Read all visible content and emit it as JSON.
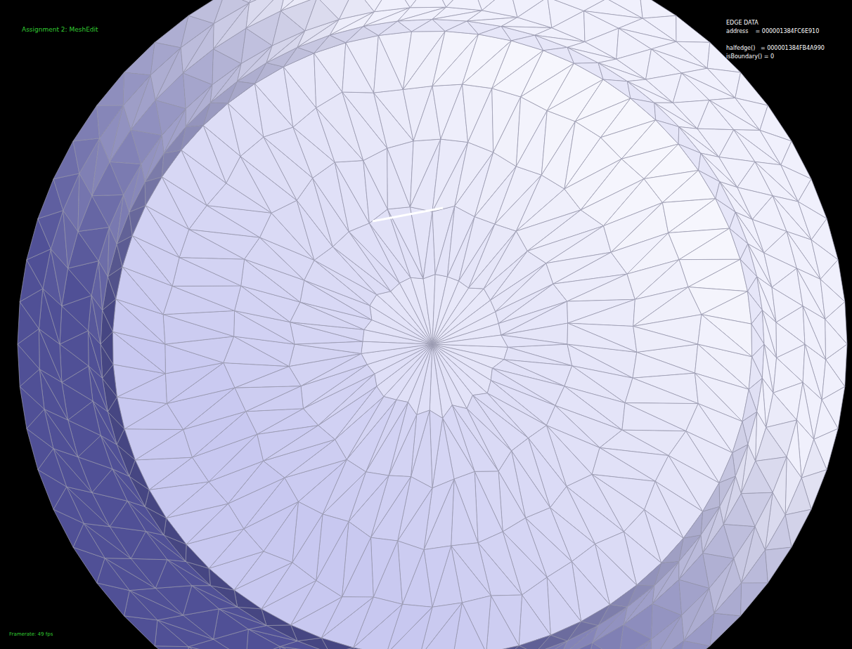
{
  "app": {
    "title": "Assignment 2: MeshEdit"
  },
  "edge_data": {
    "heading": "EDGE DATA",
    "rows": [
      "address    = 000001384FC6E910",
      "",
      "halfedge()   = 000001384FB4A990",
      "isBoundary() = 0"
    ]
  },
  "status": {
    "framerate": "Framerate: 49 fps"
  }
}
